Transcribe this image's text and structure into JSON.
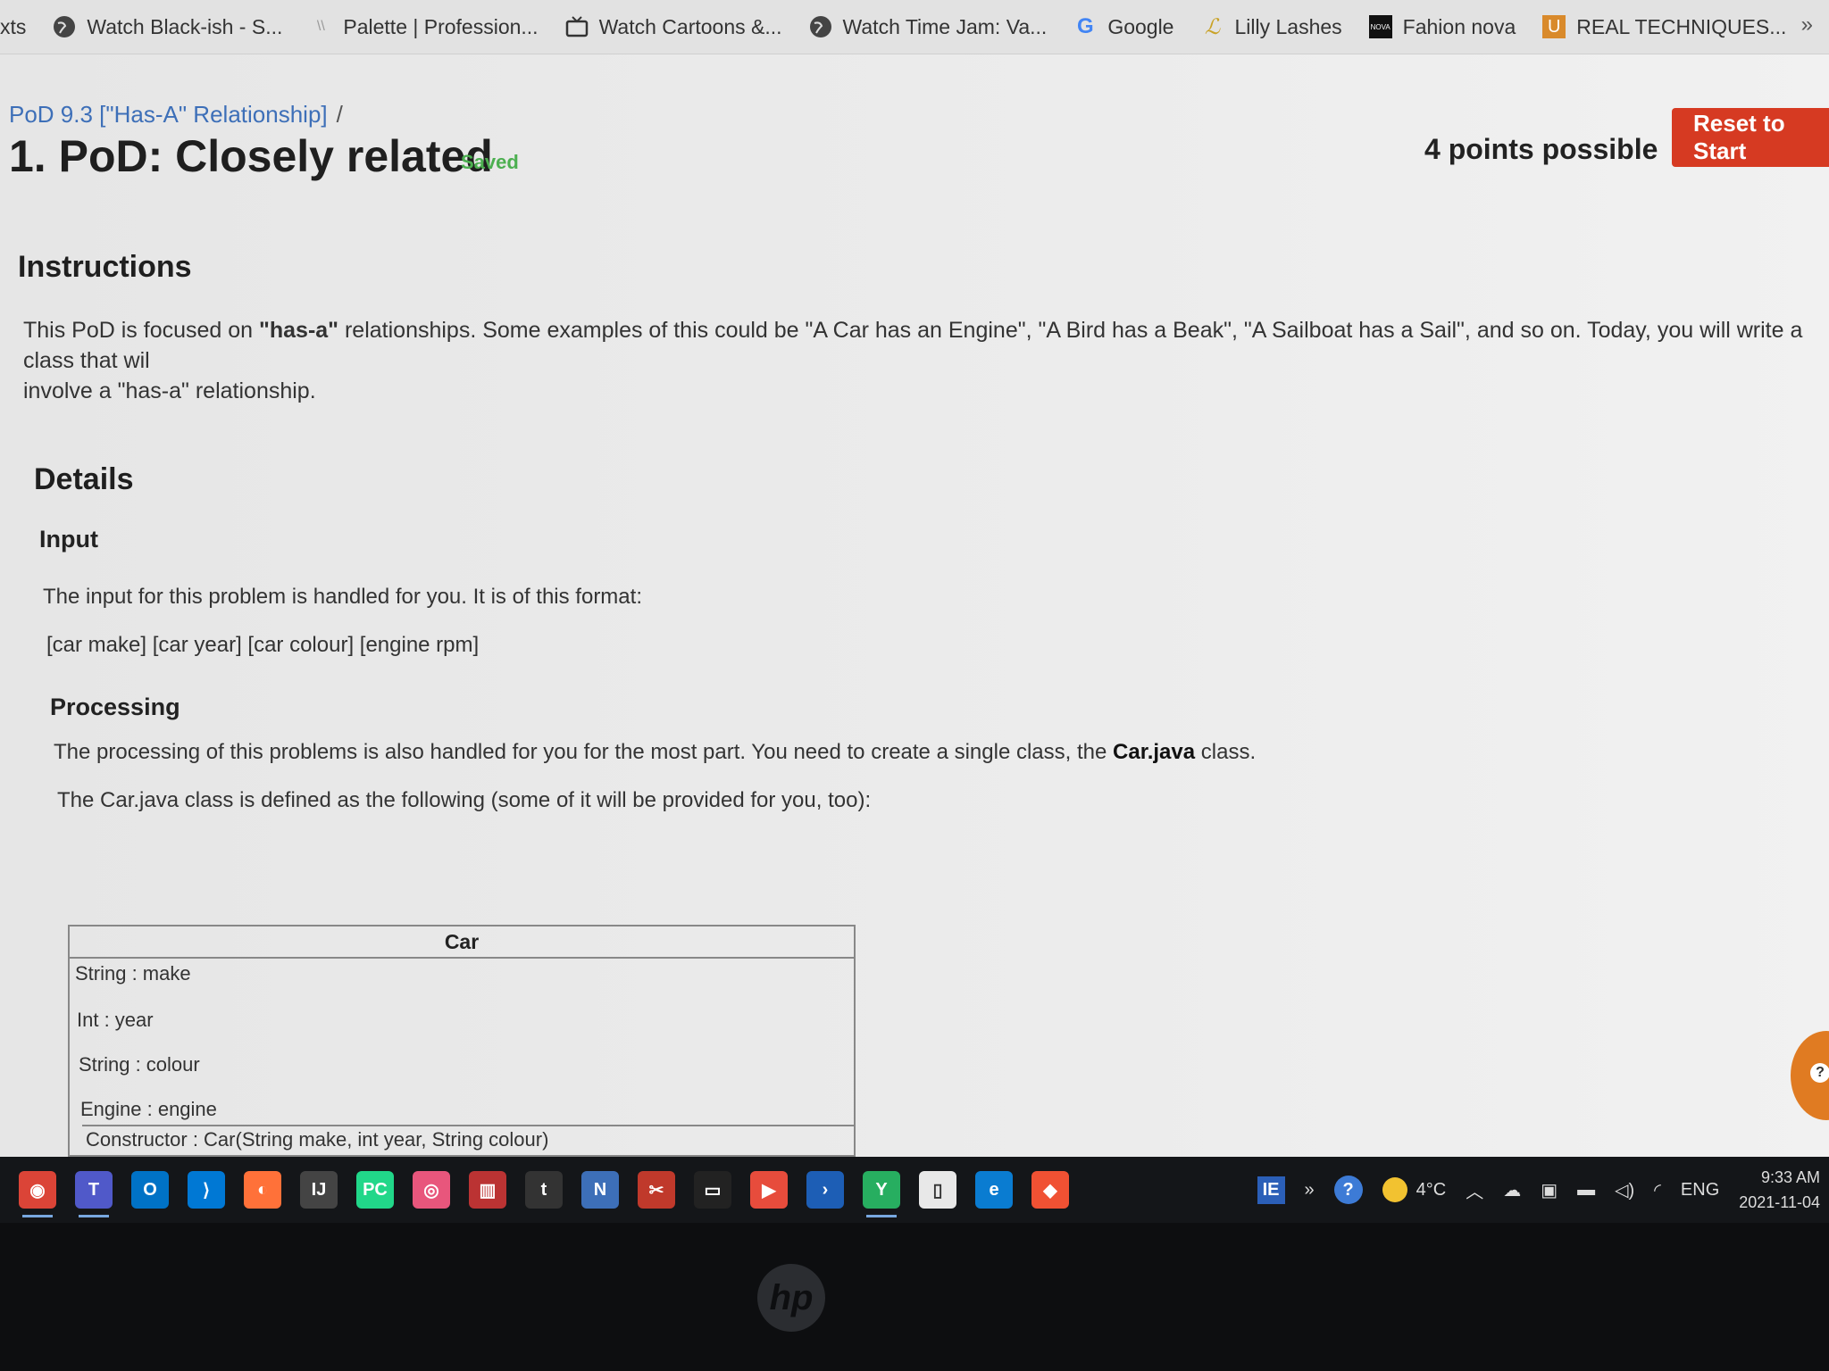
{
  "bookmarks": {
    "items": [
      {
        "label": "xts",
        "icon": ""
      },
      {
        "label": "Watch Black-ish - S...",
        "icon": "globe-icon"
      },
      {
        "label": "Palette | Profession...",
        "icon": "palette-icon"
      },
      {
        "label": "Watch Cartoons &...",
        "icon": "tv-icon"
      },
      {
        "label": "Watch Time Jam: Va...",
        "icon": "globe-icon"
      },
      {
        "label": "Google",
        "icon": "google-icon"
      },
      {
        "label": "Lilly Lashes",
        "icon": "lilly-icon"
      },
      {
        "label": "Fahion nova",
        "icon": "nova-icon"
      },
      {
        "label": "REAL TECHNIQUES...",
        "icon": "rt-icon"
      }
    ],
    "more": "»",
    "nova_glyph": "NOVA",
    "rt_glyph": "U",
    "google_glyph": "G"
  },
  "header": {
    "breadcrumb": "PoD 9.3 [\"Has-A\" Relationship]",
    "breadcrumb_sep": "/",
    "title": "1. PoD: Closely related",
    "saved": "Saved",
    "points": "4 points possible",
    "reset_label": "Reset to Start"
  },
  "instructions": {
    "heading": "Instructions",
    "text_pre": "This PoD is focused on ",
    "text_bold": "\"has-a\"",
    "text_post": " relationships. Some examples of this could be \"A Car has an Engine\", \"A Bird has a Beak\", \"A Sailboat has a Sail\", and so on. Today, you will write a class that wil",
    "text_line2": "involve a \"has-a\" relationship."
  },
  "details": {
    "heading": "Details",
    "input_heading": "Input",
    "input_text": "The input for this problem is handled for you. It is of this format:",
    "input_format": "[car make] [car year] [car colour] [engine rpm]",
    "processing_heading": "Processing",
    "processing_pre": "The processing of this problems is also handled for you for the most part. You need to create a single class, the ",
    "processing_bold": "Car.java",
    "processing_post": " class.",
    "processing_text2": "The Car.java class is defined as the following (some of it will be provided for you, too):"
  },
  "uml": {
    "class_name": "Car",
    "fields": [
      "String : make",
      "Int : year",
      "String : colour",
      "Engine : engine"
    ],
    "constructor": "Constructor : Car(String make, int year, String colour)"
  },
  "taskbar": {
    "apps": [
      {
        "name": "chrome-icon",
        "color": "#db4437",
        "glyph": "◉"
      },
      {
        "name": "teams-icon",
        "color": "#5059c9",
        "glyph": "T"
      },
      {
        "name": "outlook-icon",
        "color": "#0072c6",
        "glyph": "O"
      },
      {
        "name": "vscode-icon",
        "color": "#0078d4",
        "glyph": "⟩"
      },
      {
        "name": "firefox-icon",
        "color": "#ff7139",
        "glyph": "◐"
      },
      {
        "name": "intellij-icon",
        "color": "#444",
        "glyph": "IJ"
      },
      {
        "name": "pycharm-icon",
        "color": "#21d789",
        "glyph": "PC"
      },
      {
        "name": "photo-icon",
        "color": "#e8567c",
        "glyph": "◎"
      },
      {
        "name": "popcorn-icon",
        "color": "#b33",
        "glyph": "▥"
      },
      {
        "name": "tumblr-icon",
        "color": "#333",
        "glyph": "t"
      },
      {
        "name": "ide-icon",
        "color": "#3d6fb8",
        "glyph": "N"
      },
      {
        "name": "scissors-icon",
        "color": "#c0392b",
        "glyph": "✂"
      },
      {
        "name": "terminal-icon",
        "color": "#222",
        "glyph": "▭"
      },
      {
        "name": "slides-icon",
        "color": "#e74c3c",
        "glyph": "▶"
      },
      {
        "name": "powershell-icon",
        "color": "#1d5eb5",
        "glyph": "›"
      },
      {
        "name": "sourcetree-icon",
        "color": "#27ae60",
        "glyph": "Y"
      },
      {
        "name": "notepad-icon",
        "color": "#e8e8e8",
        "glyph": "▯"
      },
      {
        "name": "edge-icon",
        "color": "#0a7cd1",
        "glyph": "e"
      },
      {
        "name": "git-icon",
        "color": "#f05133",
        "glyph": "◆"
      }
    ],
    "tray_ie": "IE",
    "tray_more": "»",
    "tray_help": "?",
    "weather": "4°C",
    "language": "ENG",
    "time": "9:33 AM",
    "date": "2021-11-04"
  },
  "help_glyph": "?",
  "hp_logo": "hp"
}
